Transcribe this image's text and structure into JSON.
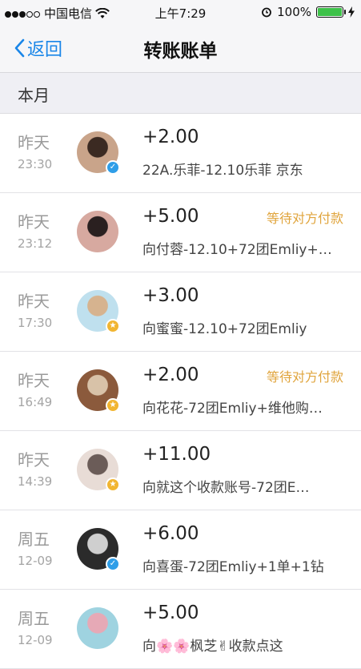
{
  "status_bar": {
    "carrier": "中国电信",
    "time": "上午7:29",
    "battery": "100%",
    "battery_level": 1.0
  },
  "nav": {
    "back_label": "返回",
    "title": "转账账单"
  },
  "section": {
    "label": "本月"
  },
  "transactions": [
    {
      "day": "昨天",
      "time": "23:30",
      "amount": "+2.00",
      "status": "",
      "desc": "22A.乐菲-12.10乐菲 京东",
      "badge": "blue"
    },
    {
      "day": "昨天",
      "time": "23:12",
      "amount": "+5.00",
      "status": "等待对方付款",
      "desc": "向付蓉-12.10+72团Emliy+…",
      "badge": ""
    },
    {
      "day": "昨天",
      "time": "17:30",
      "amount": "+3.00",
      "status": "",
      "desc": "向蜜蜜-12.10+72团Emliy",
      "badge": "gold"
    },
    {
      "day": "昨天",
      "time": "16:49",
      "amount": "+2.00",
      "status": "等待对方付款",
      "desc": "向花花-72团Emliy+维他购…",
      "badge": "gold"
    },
    {
      "day": "昨天",
      "time": "14:39",
      "amount": "+11.00",
      "status": "",
      "desc": "向就这个收款账号-72团E…",
      "badge": "gold"
    },
    {
      "day": "周五",
      "time": "12-09",
      "amount": "+6.00",
      "status": "",
      "desc": "向喜蛋-72团Emliy+1单+1钻",
      "badge": "blue"
    },
    {
      "day": "周五",
      "time": "12-09",
      "amount": "+5.00",
      "status": "",
      "desc": "向🌸🌸枫芝✌收款点这",
      "badge": ""
    }
  ],
  "colors": {
    "accent": "#1a86e8",
    "pending": "#e0a43c",
    "battery": "#3ec24a"
  }
}
